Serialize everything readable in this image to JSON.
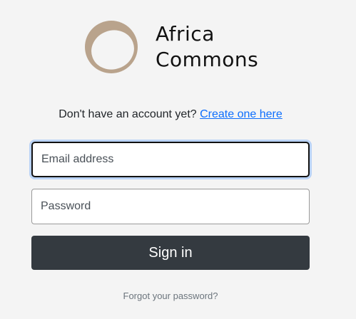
{
  "brand": {
    "name_line1": "Africa",
    "name_line2": "Commons",
    "logo_icon": "crescent-ring-logo",
    "logo_color": "#b9a38c"
  },
  "register": {
    "prompt": "Don't have an account yet?",
    "link": "Create one here"
  },
  "form": {
    "email_placeholder": "Email address",
    "email_value": "",
    "password_placeholder": "Password",
    "password_value": "",
    "submit_label": "Sign in",
    "forgot_label": "Forgot your password?"
  },
  "colors": {
    "background": "#f4f4f4",
    "button": "#343a40",
    "link": "#0d6efd"
  }
}
